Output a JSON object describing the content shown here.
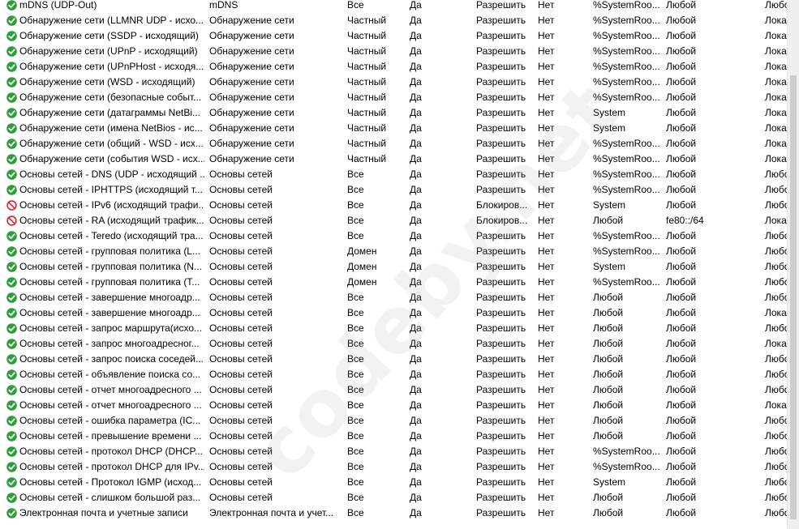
{
  "watermark": "codeby.net",
  "rules": [
    {
      "status": "allow",
      "name": "mDNS (UDP-Out)",
      "group": "mDNS",
      "profile": "Все",
      "enabled": "Да",
      "action": "Разрешить",
      "override": "Нет",
      "program": "%SystemRoo...",
      "local": "Любой",
      "remote": "Любо"
    },
    {
      "status": "allow",
      "name": "Обнаружение сети (LLMNR UDP - исхо...",
      "group": "Обнаружение сети",
      "profile": "Частный",
      "enabled": "Да",
      "action": "Разрешить",
      "override": "Нет",
      "program": "%SystemRoo...",
      "local": "Любой",
      "remote": "Локал"
    },
    {
      "status": "allow",
      "name": "Обнаружение сети (SSDP - исходящий)",
      "group": "Обнаружение сети",
      "profile": "Частный",
      "enabled": "Да",
      "action": "Разрешить",
      "override": "Нет",
      "program": "%SystemRoo...",
      "local": "Любой",
      "remote": "Локал"
    },
    {
      "status": "allow",
      "name": "Обнаружение сети (UPnP - исходящий)",
      "group": "Обнаружение сети",
      "profile": "Частный",
      "enabled": "Да",
      "action": "Разрешить",
      "override": "Нет",
      "program": "%SystemRoo...",
      "local": "Любой",
      "remote": "Локал"
    },
    {
      "status": "allow",
      "name": "Обнаружение сети (UPnPHost - исходя...",
      "group": "Обнаружение сети",
      "profile": "Частный",
      "enabled": "Да",
      "action": "Разрешить",
      "override": "Нет",
      "program": "%SystemRoo...",
      "local": "Любой",
      "remote": "Локал"
    },
    {
      "status": "allow",
      "name": "Обнаружение сети (WSD - исходящий)",
      "group": "Обнаружение сети",
      "profile": "Частный",
      "enabled": "Да",
      "action": "Разрешить",
      "override": "Нет",
      "program": "%SystemRoo...",
      "local": "Любой",
      "remote": "Локал"
    },
    {
      "status": "allow",
      "name": "Обнаружение сети (безопасные событ...",
      "group": "Обнаружение сети",
      "profile": "Частный",
      "enabled": "Да",
      "action": "Разрешить",
      "override": "Нет",
      "program": "%SystemRoo...",
      "local": "Любой",
      "remote": "Локал"
    },
    {
      "status": "allow",
      "name": "Обнаружение сети (датаграммы NetBi...",
      "group": "Обнаружение сети",
      "profile": "Частный",
      "enabled": "Да",
      "action": "Разрешить",
      "override": "Нет",
      "program": "System",
      "local": "Любой",
      "remote": "Локал"
    },
    {
      "status": "allow",
      "name": "Обнаружение сети (имена NetBios - ис...",
      "group": "Обнаружение сети",
      "profile": "Частный",
      "enabled": "Да",
      "action": "Разрешить",
      "override": "Нет",
      "program": "System",
      "local": "Любой",
      "remote": "Локал"
    },
    {
      "status": "allow",
      "name": "Обнаружение сети (общий - WSD - исх...",
      "group": "Обнаружение сети",
      "profile": "Частный",
      "enabled": "Да",
      "action": "Разрешить",
      "override": "Нет",
      "program": "%SystemRoo...",
      "local": "Любой",
      "remote": "Локал"
    },
    {
      "status": "allow",
      "name": "Обнаружение сети (события WSD - исх...",
      "group": "Обнаружение сети",
      "profile": "Частный",
      "enabled": "Да",
      "action": "Разрешить",
      "override": "Нет",
      "program": "%SystemRoo...",
      "local": "Любой",
      "remote": "Локал"
    },
    {
      "status": "allow",
      "name": "Основы сетей - DNS (UDP - исходящий ...",
      "group": "Основы сетей",
      "profile": "Все",
      "enabled": "Да",
      "action": "Разрешить",
      "override": "Нет",
      "program": "%SystemRoo...",
      "local": "Любой",
      "remote": "Любо"
    },
    {
      "status": "allow",
      "name": "Основы сетей - IPHTTPS (исходящий т...",
      "group": "Основы сетей",
      "profile": "Все",
      "enabled": "Да",
      "action": "Разрешить",
      "override": "Нет",
      "program": "%SystemRoo...",
      "local": "Любой",
      "remote": "Любо"
    },
    {
      "status": "block",
      "name": "Основы сетей - IPv6 (исходящий трафи...",
      "group": "Основы сетей",
      "profile": "Все",
      "enabled": "Да",
      "action": "Блокиров...",
      "override": "Нет",
      "program": "System",
      "local": "Любой",
      "remote": "Любо"
    },
    {
      "status": "block",
      "name": "Основы сетей - RA (исходящий трафик...",
      "group": "Основы сетей",
      "profile": "Все",
      "enabled": "Да",
      "action": "Блокиров...",
      "override": "Нет",
      "program": "Любой",
      "local": "fe80::/64",
      "remote": "Локал"
    },
    {
      "status": "allow",
      "name": "Основы сетей - Teredo (исходящий тра...",
      "group": "Основы сетей",
      "profile": "Все",
      "enabled": "Да",
      "action": "Разрешить",
      "override": "Нет",
      "program": "%SystemRoo...",
      "local": "Любой",
      "remote": "Любо"
    },
    {
      "status": "allow",
      "name": "Основы сетей - групповая политика (L...",
      "group": "Основы сетей",
      "profile": "Домен",
      "enabled": "Да",
      "action": "Разрешить",
      "override": "Нет",
      "program": "%SystemRoo...",
      "local": "Любой",
      "remote": "Любо"
    },
    {
      "status": "allow",
      "name": "Основы сетей - групповая политика (N...",
      "group": "Основы сетей",
      "profile": "Домен",
      "enabled": "Да",
      "action": "Разрешить",
      "override": "Нет",
      "program": "System",
      "local": "Любой",
      "remote": "Любо"
    },
    {
      "status": "allow",
      "name": "Основы сетей - групповая политика (T...",
      "group": "Основы сетей",
      "profile": "Домен",
      "enabled": "Да",
      "action": "Разрешить",
      "override": "Нет",
      "program": "%SystemRoo...",
      "local": "Любой",
      "remote": "Любо"
    },
    {
      "status": "allow",
      "name": "Основы сетей - завершение многоадр...",
      "group": "Основы сетей",
      "profile": "Все",
      "enabled": "Да",
      "action": "Разрешить",
      "override": "Нет",
      "program": "Любой",
      "local": "Любой",
      "remote": "Любо"
    },
    {
      "status": "allow",
      "name": "Основы сетей - завершение многоадр...",
      "group": "Основы сетей",
      "profile": "Все",
      "enabled": "Да",
      "action": "Разрешить",
      "override": "Нет",
      "program": "Любой",
      "local": "Любой",
      "remote": "Локал"
    },
    {
      "status": "allow",
      "name": "Основы сетей - запрос маршрута(исхо...",
      "group": "Основы сетей",
      "profile": "Все",
      "enabled": "Да",
      "action": "Разрешить",
      "override": "Нет",
      "program": "Любой",
      "local": "Любой",
      "remote": "Любо"
    },
    {
      "status": "allow",
      "name": "Основы сетей - запрос многоадресног...",
      "group": "Основы сетей",
      "profile": "Все",
      "enabled": "Да",
      "action": "Разрешить",
      "override": "Нет",
      "program": "Любой",
      "local": "Любой",
      "remote": "Локал"
    },
    {
      "status": "allow",
      "name": "Основы сетей - запрос поиска соседей...",
      "group": "Основы сетей",
      "profile": "Все",
      "enabled": "Да",
      "action": "Разрешить",
      "override": "Нет",
      "program": "Любой",
      "local": "Любой",
      "remote": "Любо"
    },
    {
      "status": "allow",
      "name": "Основы сетей - объявление поиска со...",
      "group": "Основы сетей",
      "profile": "Все",
      "enabled": "Да",
      "action": "Разрешить",
      "override": "Нет",
      "program": "Любой",
      "local": "Любой",
      "remote": "Любо"
    },
    {
      "status": "allow",
      "name": "Основы сетей - отчет многоадресного ...",
      "group": "Основы сетей",
      "profile": "Все",
      "enabled": "Да",
      "action": "Разрешить",
      "override": "Нет",
      "program": "Любой",
      "local": "Любой",
      "remote": "Любо"
    },
    {
      "status": "allow",
      "name": "Основы сетей - отчет многоадресного ...",
      "group": "Основы сетей",
      "profile": "Все",
      "enabled": "Да",
      "action": "Разрешить",
      "override": "Нет",
      "program": "Любой",
      "local": "Любой",
      "remote": "Локал"
    },
    {
      "status": "allow",
      "name": "Основы сетей - ошибка параметра (IC...",
      "group": "Основы сетей",
      "profile": "Все",
      "enabled": "Да",
      "action": "Разрешить",
      "override": "Нет",
      "program": "Любой",
      "local": "Любой",
      "remote": "Любо"
    },
    {
      "status": "allow",
      "name": "Основы сетей - превышение времени ...",
      "group": "Основы сетей",
      "profile": "Все",
      "enabled": "Да",
      "action": "Разрешить",
      "override": "Нет",
      "program": "Любой",
      "local": "Любой",
      "remote": "Любо"
    },
    {
      "status": "allow",
      "name": "Основы сетей - протокол DHCP (DHCP...",
      "group": "Основы сетей",
      "profile": "Все",
      "enabled": "Да",
      "action": "Разрешить",
      "override": "Нет",
      "program": "%SystemRoo...",
      "local": "Любой",
      "remote": "Любо"
    },
    {
      "status": "allow",
      "name": "Основы сетей - протокол DHCP для IPv...",
      "group": "Основы сетей",
      "profile": "Все",
      "enabled": "Да",
      "action": "Разрешить",
      "override": "Нет",
      "program": "%SystemRoo...",
      "local": "Любой",
      "remote": "Любо"
    },
    {
      "status": "allow",
      "name": "Основы сетей - Протокол IGMP (исход...",
      "group": "Основы сетей",
      "profile": "Все",
      "enabled": "Да",
      "action": "Разрешить",
      "override": "Нет",
      "program": "System",
      "local": "Любой",
      "remote": "Любо"
    },
    {
      "status": "allow",
      "name": "Основы сетей - слишком большой раз...",
      "group": "Основы сетей",
      "profile": "Все",
      "enabled": "Да",
      "action": "Разрешить",
      "override": "Нет",
      "program": "Любой",
      "local": "Любой",
      "remote": "Любо"
    },
    {
      "status": "allow",
      "name": "Электронная почта и учетные записи",
      "group": "Электронная почта и учет...",
      "profile": "Все",
      "enabled": "Да",
      "action": "Разрешить",
      "override": "Нет",
      "program": "Любой",
      "local": "Любой",
      "remote": "Любо"
    }
  ],
  "icons": {
    "allow": "check-circle-icon",
    "block": "block-icon"
  },
  "colors": {
    "allow_icon": "#2e9e3a",
    "block_icon": "#d8232a"
  }
}
